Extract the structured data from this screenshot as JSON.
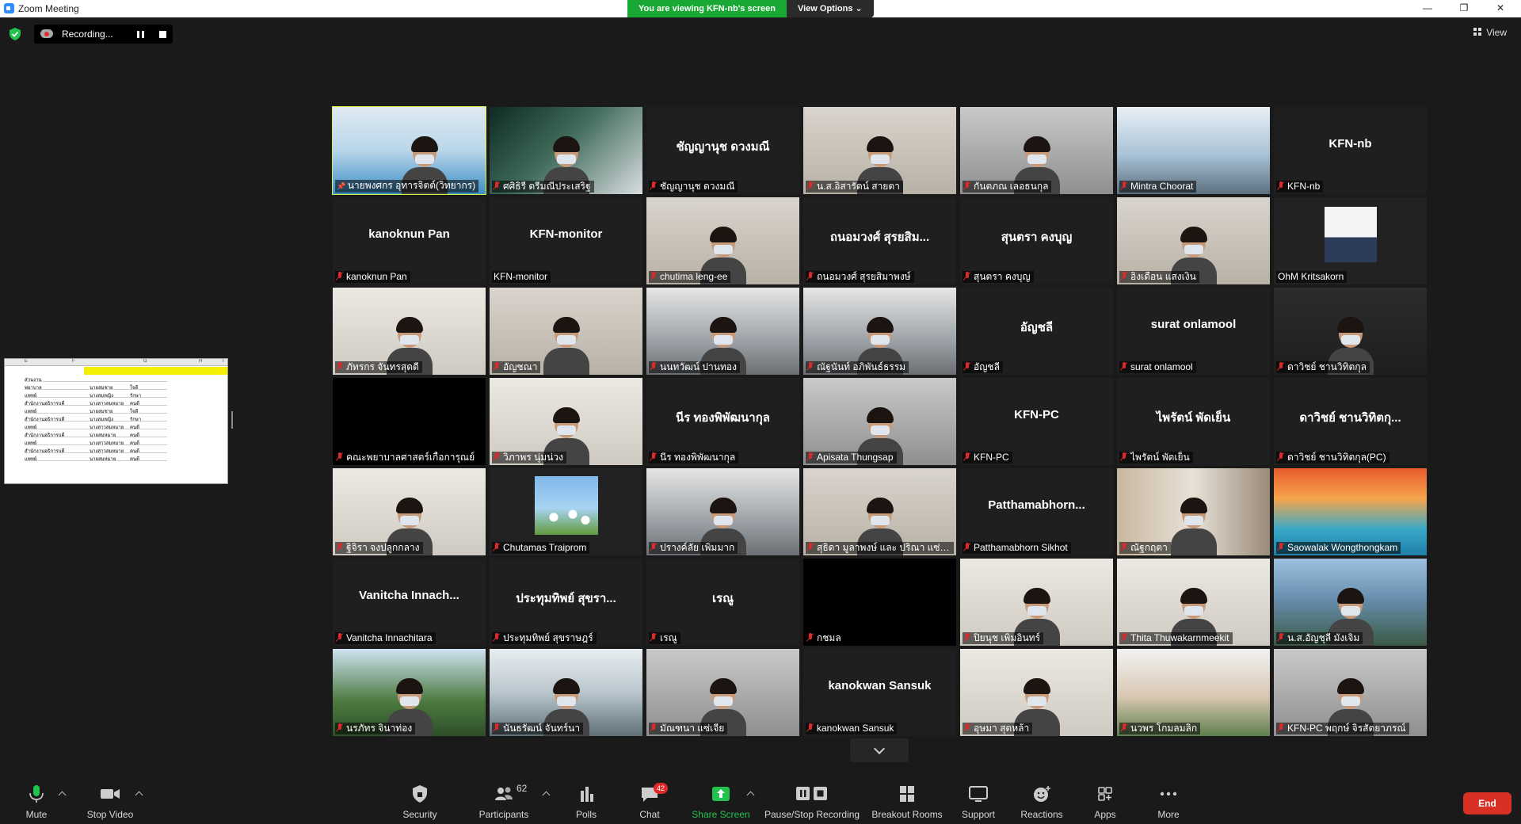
{
  "window": {
    "title": "Zoom Meeting",
    "share_banner": "You are viewing KFN-nb's screen",
    "view_options": "View Options",
    "minimize": "—",
    "maximize": "❐",
    "close": "✕"
  },
  "status": {
    "recording_label": "Recording...",
    "view_label": "View"
  },
  "shared_screen": {
    "columns": [
      "E",
      "F",
      "G",
      "H",
      "I"
    ],
    "rows": [
      [
        "ส่วนงาน",
        "",
        ""
      ],
      [
        "พยาบาล",
        "นายสมชาย",
        "ใจดี"
      ],
      [
        "แพทย์",
        "นางสมหญิง",
        "รักษา"
      ],
      [
        "สำนักงานอธิการบดี",
        "นางสาวสมหมาย",
        "คนดี"
      ],
      [
        "แพทย์",
        "นายสมชาย",
        "ใจดี"
      ],
      [
        "สำนักงานอธิการบดี",
        "นางสมหญิง",
        "รักษา"
      ],
      [
        "แพทย์",
        "นางสาวสมหมาย",
        "คนดี"
      ],
      [
        "สำนักงานอธิการบดี",
        "นายสมหมาย",
        "คนดี"
      ],
      [
        "แพทย์",
        "นางสาวสมหมาย",
        "คนดี"
      ],
      [
        "สำนักงานอธิการบดี",
        "นางสาวสมหมาย",
        "คนดี"
      ],
      [
        "แพทย์",
        "นายสมหมาย",
        "คนดี"
      ]
    ]
  },
  "participants": [
    {
      "label": "นายพงศกร อุทารจิตต์(วิทยากร)",
      "big": "",
      "kind": "slide",
      "muted": false,
      "pinned": true,
      "active": true
    },
    {
      "label": "ศศิธิรี ตรีมณีประเสริฐ",
      "big": "",
      "kind": "dark-cam",
      "muted": true
    },
    {
      "label": "ชัญญานุช ดวงมณี",
      "big": "ชัญญานุช ดวงมณี",
      "kind": "name",
      "muted": true
    },
    {
      "label": "น.ส.อิสารัตน์ สายตา",
      "big": "",
      "kind": "cam",
      "muted": true
    },
    {
      "label": "กันตภณ เลอธนกุล",
      "big": "",
      "kind": "cam-grey",
      "muted": true
    },
    {
      "label": "Mintra Choorat",
      "big": "",
      "kind": "building",
      "muted": true
    },
    {
      "label": "KFN-nb",
      "big": "KFN-nb",
      "kind": "name",
      "muted": true
    },
    {
      "label": "kanoknun Pan",
      "big": "kanoknun Pan",
      "kind": "name",
      "muted": true
    },
    {
      "label": "KFN-monitor",
      "big": "KFN-monitor",
      "kind": "name",
      "muted": false
    },
    {
      "label": "chutima leng-ee",
      "big": "",
      "kind": "cam",
      "muted": true
    },
    {
      "label": "ถนอมวงศ์ สุรยสิมาพงษ์",
      "big": "ถนอมวงศ์ สุรยสิม...",
      "kind": "name",
      "muted": true
    },
    {
      "label": "สุนตรา คงบุญ",
      "big": "สุนตรา คงบุญ",
      "kind": "name",
      "muted": true
    },
    {
      "label": "อิงเดือน แสงเงิน",
      "big": "",
      "kind": "cam",
      "muted": true
    },
    {
      "label": "OhM Kritsakorn",
      "big": "",
      "kind": "portrait",
      "muted": false
    },
    {
      "label": "ภัทรกร จันทรสุดดี",
      "big": "",
      "kind": "cam-light",
      "muted": true
    },
    {
      "label": "อัญชณา",
      "big": "",
      "kind": "cam",
      "muted": true
    },
    {
      "label": "นนทวัฒน์ ปานทอง",
      "big": "",
      "kind": "office",
      "muted": true
    },
    {
      "label": "ณัฐนันท์ อภิพันธ์ธรรม",
      "big": "",
      "kind": "office",
      "muted": true
    },
    {
      "label": "อัญชลี",
      "big": "อัญชลี",
      "kind": "name",
      "muted": true
    },
    {
      "label": "surat onlamool",
      "big": "surat onlamool",
      "kind": "name",
      "muted": true
    },
    {
      "label": "ดาวิชย์ ชานวิทิตกุล",
      "big": "",
      "kind": "portrait-room",
      "muted": true
    },
    {
      "label": "คณะพยาบาลศาสตร์เกื้อการุณย์",
      "big": "",
      "kind": "black",
      "muted": true
    },
    {
      "label": "วิภาพร นุ่มน่วง",
      "big": "",
      "kind": "cam-light",
      "muted": true
    },
    {
      "label": "นีร ทองพิพัฒนากุล",
      "big": "นีร ทองพิพัฒนากุล",
      "kind": "name",
      "muted": true
    },
    {
      "label": "Apisata Thungsap",
      "big": "",
      "kind": "cam-grey",
      "muted": true
    },
    {
      "label": "KFN-PC",
      "big": "KFN-PC",
      "kind": "name",
      "muted": true
    },
    {
      "label": "ไพรัตน์ พัดเย็น",
      "big": "ไพรัตน์ พัดเย็น",
      "kind": "name",
      "muted": true
    },
    {
      "label": "ดาวิชย์ ชานวิทิตกุล(PC)",
      "big": "ดาวิชย์ ชานวิทิตกุ...",
      "kind": "name",
      "muted": true
    },
    {
      "label": "ฐิจิรา จงปลูกกลาง",
      "big": "",
      "kind": "cam-light",
      "muted": true
    },
    {
      "label": "Chutamas Traiprom",
      "big": "",
      "kind": "flowers",
      "muted": true
    },
    {
      "label": "ปรางค์ลัย เพิ่มมาก",
      "big": "",
      "kind": "office",
      "muted": true
    },
    {
      "label": "สุธิดา มูลาพงษ์ และ ปริณา แซ่ฉิน",
      "big": "",
      "kind": "cam",
      "muted": true
    },
    {
      "label": "Patthamabhorn Sikhot",
      "big": "Patthamabhorn...",
      "kind": "name",
      "muted": true
    },
    {
      "label": "ณัฐกฤตา",
      "big": "",
      "kind": "room",
      "muted": true
    },
    {
      "label": "Saowalak Wongthongkam",
      "big": "",
      "kind": "sunset",
      "muted": true
    },
    {
      "label": "Vanitcha Innachitara",
      "big": "Vanitcha Innach...",
      "kind": "name",
      "muted": true
    },
    {
      "label": "ประทุมทิพย์ สุขราษฎร์",
      "big": "ประทุมทิพย์ สุขรา...",
      "kind": "name",
      "muted": true
    },
    {
      "label": "เรณู",
      "big": "เรณู",
      "kind": "name",
      "muted": true
    },
    {
      "label": "กชมล",
      "big": "",
      "kind": "black",
      "muted": true
    },
    {
      "label": "ปิยนุช เพิ่มอินทร์",
      "big": "",
      "kind": "cam-light",
      "muted": true
    },
    {
      "label": "Thita Thuwakarnmeekit",
      "big": "",
      "kind": "cam-light",
      "muted": true
    },
    {
      "label": "น.ส.อัญชุลี มั่งเจิม",
      "big": "",
      "kind": "mountain",
      "muted": true
    },
    {
      "label": "นรภัทร จินาท่อง",
      "big": "",
      "kind": "outdoor",
      "muted": true
    },
    {
      "label": "นันธรัฒน์ จันทร์นา",
      "big": "",
      "kind": "window",
      "muted": true
    },
    {
      "label": "มัณฑนา แซ่เจีย",
      "big": "",
      "kind": "cam-grey",
      "muted": true
    },
    {
      "label": "kanokwan Sansuk",
      "big": "kanokwan Sansuk",
      "kind": "name",
      "muted": true
    },
    {
      "label": "อุษมา สุดหล้า",
      "big": "",
      "kind": "cam-light",
      "muted": true
    },
    {
      "label": "นวพร โกมลมลิก",
      "big": "",
      "kind": "hospital",
      "muted": true
    },
    {
      "label": "KFN-PC พฤกษ์ จิรสัตยาภรณ์",
      "big": "",
      "kind": "cam-grey",
      "muted": true
    }
  ],
  "toolbar": {
    "mute": "Mute",
    "stop_video": "Stop Video",
    "security": "Security",
    "participants": "Participants",
    "participants_count": "62",
    "polls": "Polls",
    "chat": "Chat",
    "chat_badge": "42",
    "share_screen": "Share Screen",
    "pause_stop_recording": "Pause/Stop Recording",
    "breakout_rooms": "Breakout Rooms",
    "support": "Support",
    "reactions": "Reactions",
    "apps": "Apps",
    "more": "More",
    "end": "End"
  },
  "colors": {
    "active_speaker": "#d7f23e",
    "share_banner": "#1aa835",
    "end_button": "#d93025",
    "muted_mic": "#e02828"
  }
}
